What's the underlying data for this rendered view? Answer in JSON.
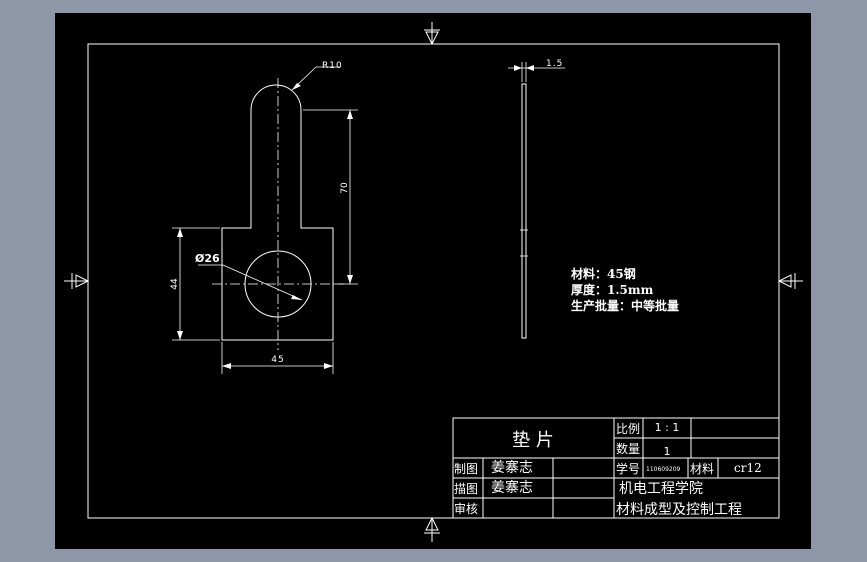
{
  "drawing": {
    "dimensions": {
      "radius": "R10",
      "height": "70",
      "diameter": "Ø26",
      "total_height": "44",
      "width": "45",
      "thickness": "1.5"
    },
    "notes": {
      "material": "材料：45钢",
      "thickness": "厚度：1.5mm",
      "batch": "生产批量：中等批量"
    }
  },
  "title_block": {
    "part_name": "垫 片",
    "scale_label": "比例",
    "scale_value": "1 : 1",
    "qty_label": "数量",
    "qty_value": "1",
    "drawn_label": "制图",
    "drawn_by": "姜寨志",
    "traced_label": "描图",
    "traced_by": "姜寨志",
    "review_label": "审核",
    "student_id_label": "学号",
    "student_id": "110609209",
    "material_label": "材料",
    "material_value": "cr12",
    "school": "机电工程学院",
    "major": "材料成型及控制工程"
  },
  "colors": {
    "background": "#8d97a7",
    "sheet": "#000000",
    "line": "#ffffff"
  }
}
